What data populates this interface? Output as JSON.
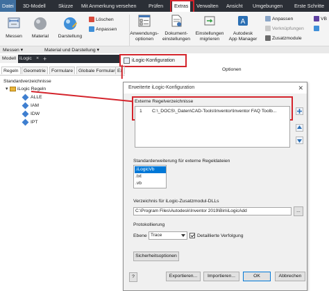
{
  "menu_tabs": [
    "Datei",
    "3D-Modell",
    "Skizze",
    "Mit Anmerkung versehen",
    "Prüfen",
    "Extras",
    "Verwalten",
    "Ansicht",
    "Umgebungen",
    "Erste Schritte"
  ],
  "ribbon": {
    "messen": "Messen",
    "material": "Material",
    "darstellung": "Darstellung",
    "loeschen": "Löschen",
    "anpassen": "Anpassen",
    "anwendungsoptionen": [
      "Anwendungs-",
      "optionen"
    ],
    "dokumenteinstellungen": [
      "Dokument-",
      "einstellungen"
    ],
    "einstellungen_migrieren": [
      "Einstellungen",
      "migrieren"
    ],
    "app_manager": [
      "Autodesk",
      "App Manager"
    ],
    "anpassen2": "Anpassen",
    "verknuepfungen": "Verknüpfungen",
    "zusatzmodule": "Zusatzmodule",
    "vb": "VB",
    "panel_messen": "Messen ▾",
    "panel_material": "Material und Darstellung ▾",
    "panel_optionen": "Optionen"
  },
  "ilogic_popup": "iLogic-Konfiguration",
  "doc_tabs": [
    "Modell",
    "iLogic"
  ],
  "doc_close": "×",
  "doc_plus": "+",
  "browser_tabs": [
    "Regeln",
    "Geometrie",
    "Formulare",
    "Globale Formulare",
    "Ex"
  ],
  "tree": {
    "root": "Standardverzeichnisse",
    "ilogic_regeln": "iLogic Regeln",
    "children": [
      "ALLE",
      "IAM",
      "IDW",
      "IPT"
    ]
  },
  "dialog": {
    "title": "Erweiterte iLogic-Konfiguration",
    "close": "✕",
    "ext_dirs_label": "Externe Regelverzeichnisse",
    "ext_dirs": [
      {
        "num": "1",
        "path": "C:\\_DOCS\\_Daten\\CAD-Tools\\Inventor\\Inventor FAQ Toolb..."
      }
    ],
    "default_ext_label": "Standarderweiterung für externe Regeldateien",
    "default_exts": [
      ".iLogicVb",
      ".txt",
      ".vb"
    ],
    "dll_label": "Verzeichnis für iLogic-Zusatzmodul-DLLs",
    "dll_path": "C:\\Program Files\\Autodesk\\Inventor 2019\\Bin\\iLogicAdd",
    "browse": "...",
    "log_label": "Protokollierung",
    "level_label": "Ebene",
    "level_value": "Trace",
    "detailed_trace": "Detaillierte Verfolgung",
    "security_btn": "Sicherheitsoptionen",
    "help": "?",
    "export_btn": "Exportieren...",
    "import_btn": "Importieren...",
    "ok_btn": "OK",
    "cancel_btn": "Abbrechen"
  }
}
